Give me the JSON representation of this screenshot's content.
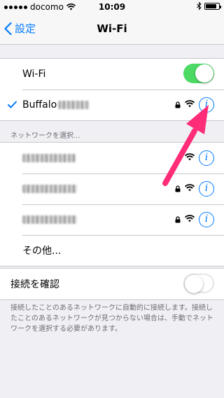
{
  "status_bar": {
    "carrier": "docomo",
    "time": "10:09"
  },
  "nav": {
    "back_label": "設定",
    "title": "Wi-Fi"
  },
  "wifi_toggle": {
    "label": "Wi-Fi",
    "on": true
  },
  "connected_network": {
    "name": "Buffalo",
    "locked": true
  },
  "networks_header": "ネットワークを選択...",
  "networks": [
    {
      "locked": false
    },
    {
      "locked": true
    },
    {
      "locked": true
    }
  ],
  "other_label": "その他...",
  "ask_to_join": {
    "label": "接続を確認",
    "on": false
  },
  "ask_to_join_note": "接続したことのあるネットワークに自動的に接続します。接続したことのあるネットワークが見つからない場合は、手動でネットワークを選択する必要があります。",
  "colors": {
    "accent": "#007aff",
    "toggle_on": "#4cd964",
    "arrow": "#ff2d78"
  }
}
